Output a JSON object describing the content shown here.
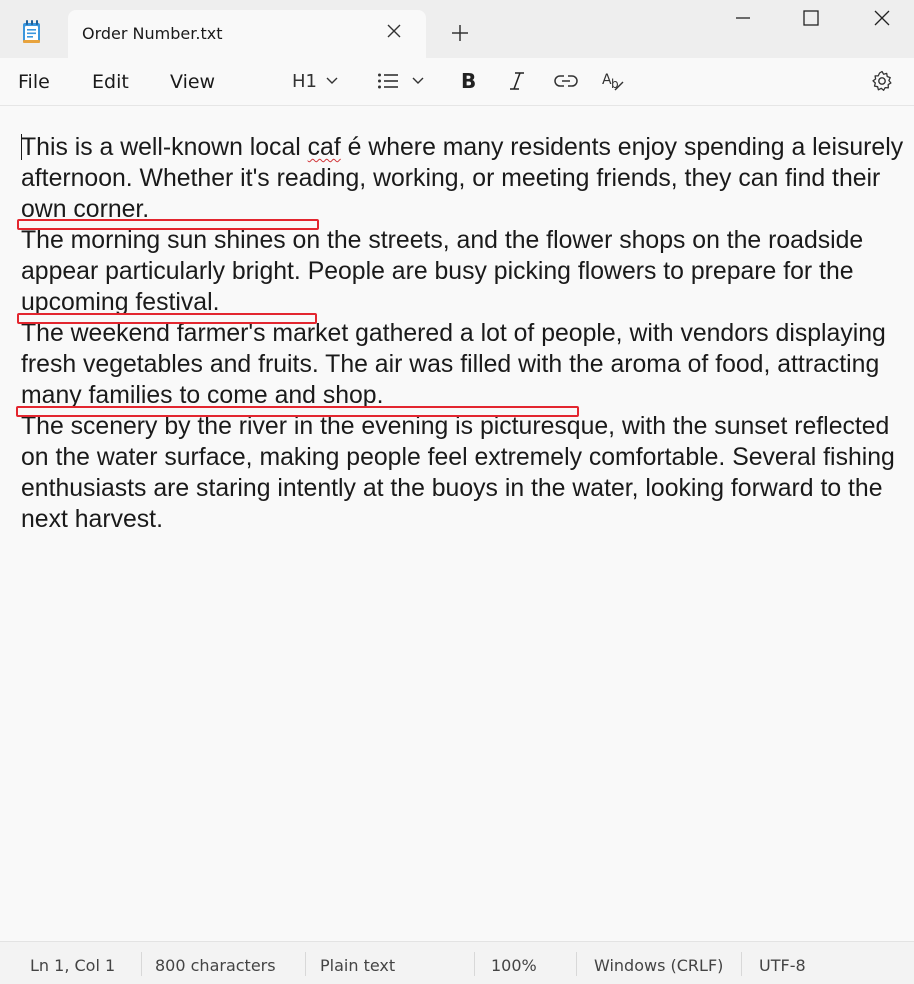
{
  "window": {
    "tab_title": "Order Number.txt",
    "icons": {
      "app": "notepad-icon",
      "tab_close": "close-icon",
      "new_tab": "plus-icon",
      "minimize": "minimize-icon",
      "maximize": "maximize-icon",
      "close": "close-window-icon"
    }
  },
  "menu": {
    "file": "File",
    "edit": "Edit",
    "view": "View"
  },
  "toolbar": {
    "heading_label": "H1",
    "icons": [
      "chevron-down-icon",
      "list-icon",
      "bold-icon",
      "italic-icon",
      "link-icon",
      "clear-formatting-icon",
      "settings-icon"
    ]
  },
  "editor": {
    "paragraphs": {
      "p1_before": "This is a well-known local ",
      "p1_misspelled": "caf",
      "p1_after": " é where many residents enjoy spending a leisurely afternoon. Whether it's reading, working, or meeting friends, they can find their own corner.",
      "p2": "The morning sun shines on the streets, and the flower shops on the roadside appear particularly bright. People are busy picking flowers to prepare for the upcoming festival.",
      "p3": "The weekend farmer's market gathered a lot of people, with vendors displaying fresh vegetables and fruits. The air was filled with the aroma of food, attracting many families to come and shop.",
      "p4": "The scenery by the river in the evening is picturesque, with the sunset reflected on the water surface, making people feel extremely comfortable. Several fishing enthusiasts are staring intently at the buoys in the water, looking forward to the next harvest."
    },
    "annotation_color": "#e3262f"
  },
  "status": {
    "position": "Ln 1, Col 1",
    "characters": "800 characters",
    "format": "Plain text",
    "zoom": "100%",
    "line_ending": "Windows (CRLF)",
    "encoding": "UTF-8"
  }
}
